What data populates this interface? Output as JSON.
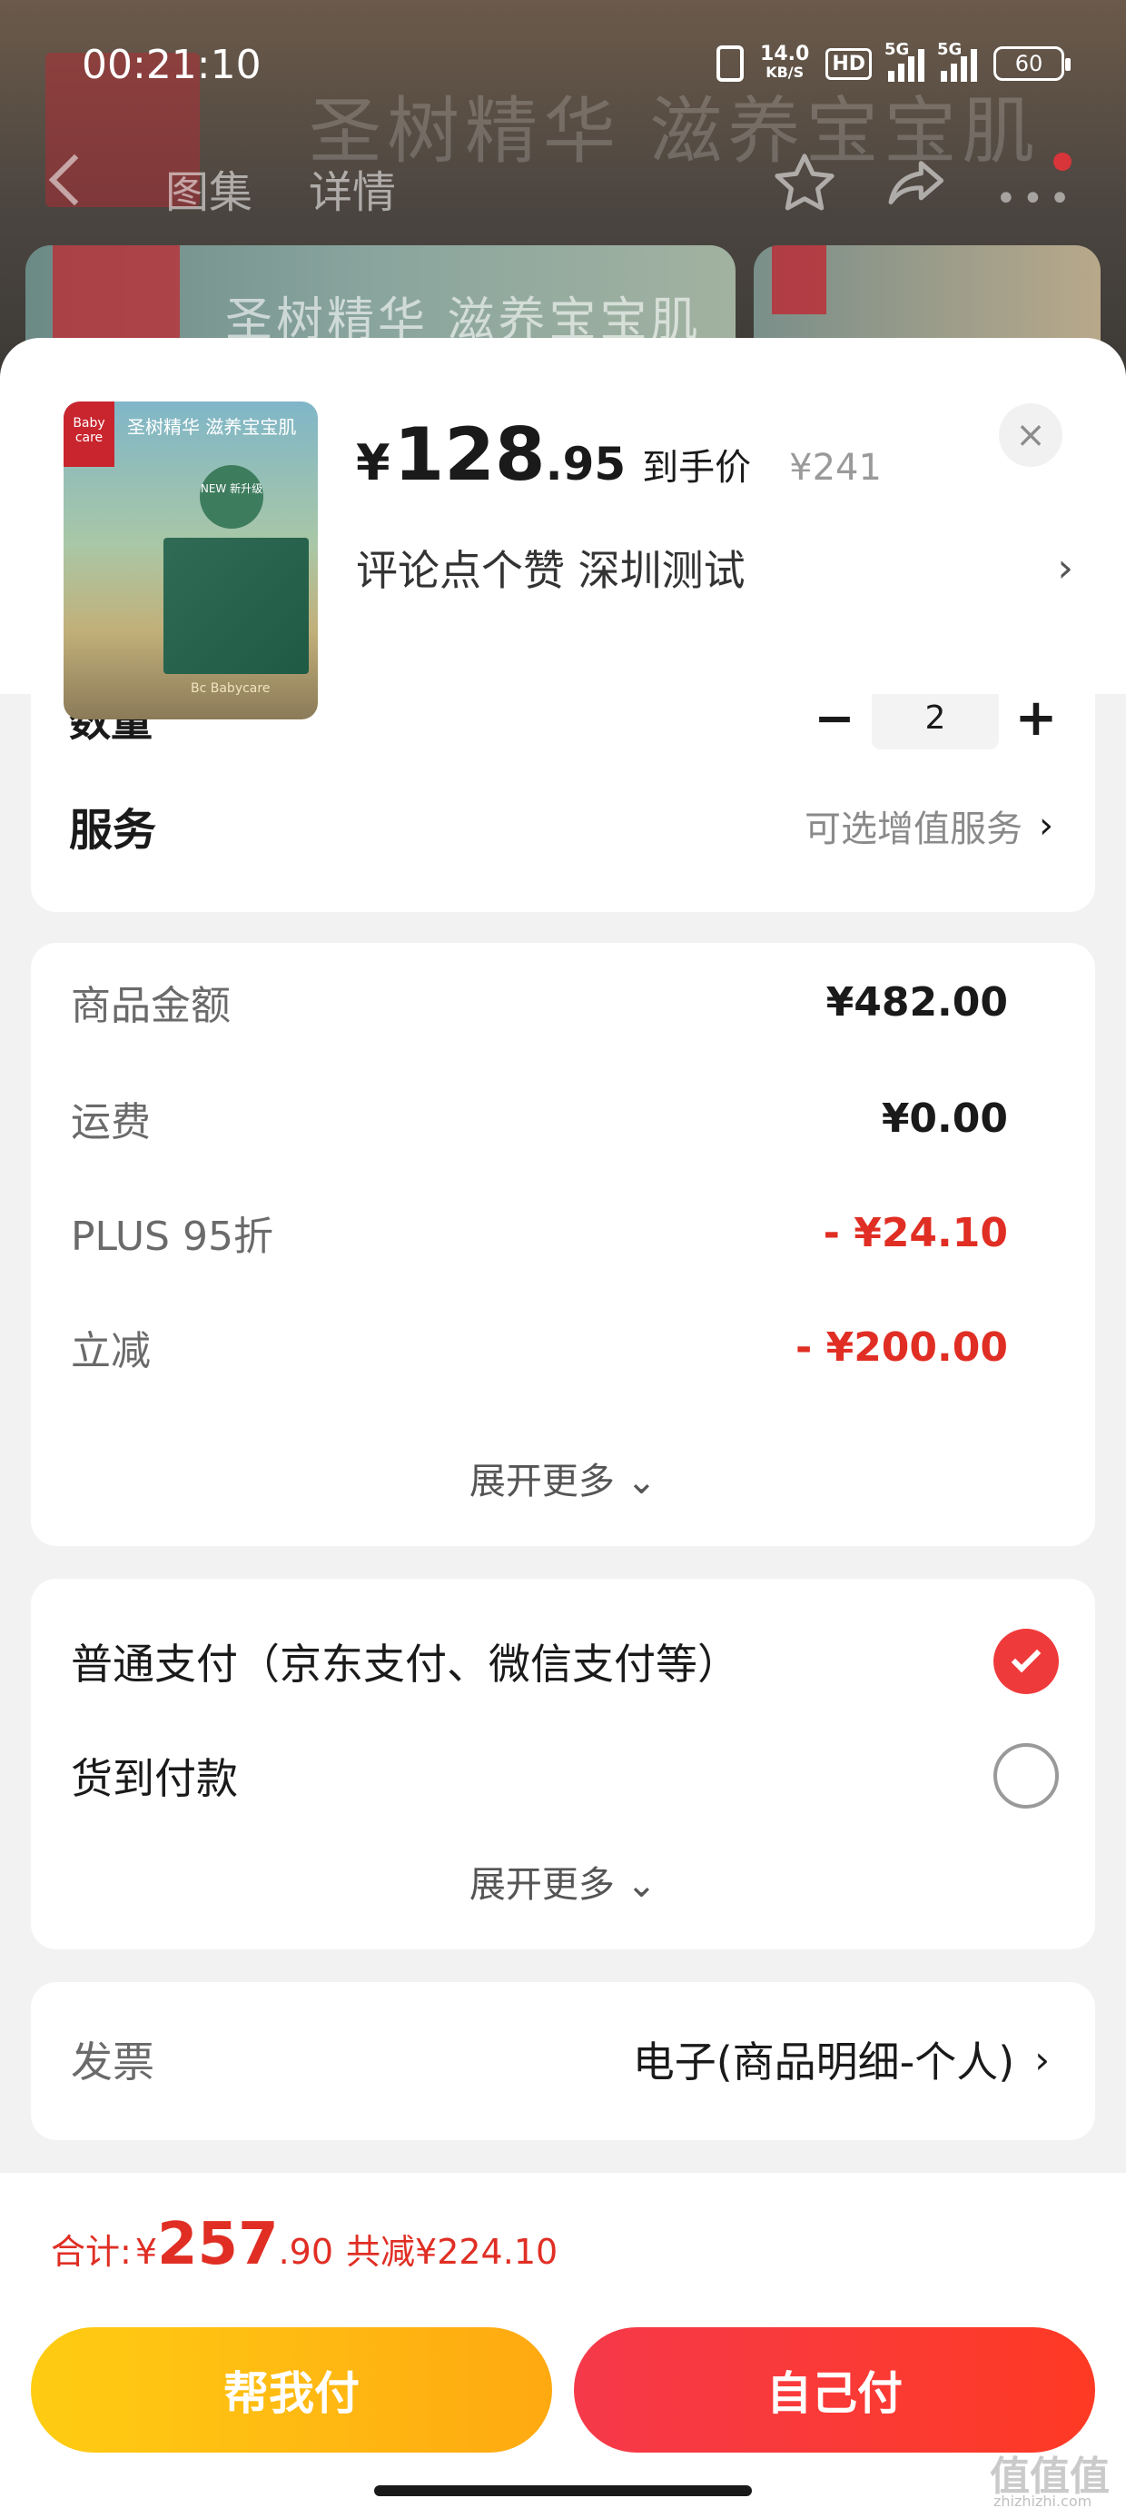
{
  "status_bar": {
    "time": "00:21:10",
    "net_speed_value": "14.0",
    "net_speed_unit": "KB/S",
    "hd_badge": "HD",
    "signal1_label": "5G",
    "signal2_label": "5G",
    "battery": "60"
  },
  "background_page": {
    "banner_text": "圣树精华 滋养宝宝肌",
    "brand": "Baby care",
    "tabs": [
      "图集",
      "详情"
    ],
    "card1_text": "圣树精华 滋养宝宝肌"
  },
  "product": {
    "thumb_logo": "Baby care",
    "thumb_banner": "圣树精华 滋养宝宝肌",
    "thumb_badge": "NEW 新升级",
    "thumb_brand": "Bc Babycare",
    "price_yen": "¥",
    "price_int": "128",
    "price_dec": ".95",
    "price_label": "到手价",
    "orig_price": "¥241",
    "spec_text": "评论点个赞  深圳测试",
    "close_icon": "×",
    "chevron": "›"
  },
  "quantity": {
    "label": "数量",
    "minus": "−",
    "value": "2",
    "plus": "+"
  },
  "service": {
    "label": "服务",
    "value": "可选增值服务",
    "chevron": "›"
  },
  "fees": {
    "rows": [
      {
        "label": "商品金额",
        "value": "¥482.00"
      },
      {
        "label": "运费",
        "value": "¥0.00"
      },
      {
        "label": "PLUS 95折",
        "value": "- ¥24.10"
      },
      {
        "label": "立减",
        "value": "- ¥200.00"
      }
    ],
    "expand": "展开更多 ⌄"
  },
  "payment": {
    "options": [
      {
        "label": "普通支付（京东支付、微信支付等）",
        "selected": true
      },
      {
        "label": "货到付款",
        "selected": false
      }
    ],
    "expand": "展开更多 ⌄"
  },
  "invoice": {
    "label": "发票",
    "value": "电子(商品明细-个人)",
    "chevron": "›"
  },
  "total": {
    "label": "合计:",
    "yen": "¥",
    "int": "257",
    "dec": ".90",
    "saved": "共减¥224.10"
  },
  "buttons": {
    "help_pay": "帮我付",
    "self_pay": "自己付"
  },
  "watermark": {
    "text": "值值值",
    "sub": "zhizhizhi.com"
  },
  "colors": {
    "accent_red": "#e02e24",
    "btn_yellow": "#ffb811",
    "btn_red": "#f6394a"
  }
}
